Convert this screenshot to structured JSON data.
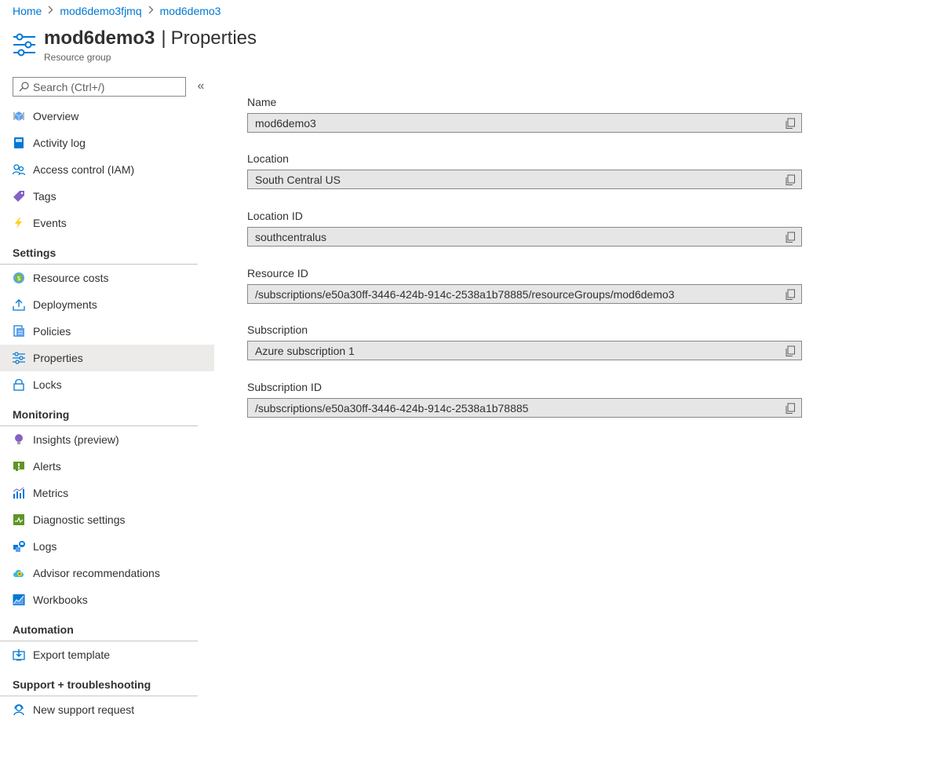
{
  "breadcrumb": {
    "items": [
      "Home",
      "mod6demo3fjmq",
      "mod6demo3"
    ]
  },
  "header": {
    "resource_name": "mod6demo3",
    "separator": "|",
    "section": "Properties",
    "subtitle": "Resource group"
  },
  "search": {
    "placeholder": "Search (Ctrl+/)"
  },
  "collapse_label": "«",
  "sidebar": {
    "top_items": [
      {
        "label": "Overview",
        "icon": "overview-icon"
      },
      {
        "label": "Activity log",
        "icon": "activity-log-icon"
      },
      {
        "label": "Access control (IAM)",
        "icon": "iam-icon"
      },
      {
        "label": "Tags",
        "icon": "tag-icon"
      },
      {
        "label": "Events",
        "icon": "events-icon"
      }
    ],
    "groups": [
      {
        "title": "Settings",
        "items": [
          {
            "label": "Resource costs",
            "icon": "costs-icon"
          },
          {
            "label": "Deployments",
            "icon": "deployments-icon"
          },
          {
            "label": "Policies",
            "icon": "policies-icon"
          },
          {
            "label": "Properties",
            "icon": "properties-icon",
            "active": true
          },
          {
            "label": "Locks",
            "icon": "lock-icon"
          }
        ]
      },
      {
        "title": "Monitoring",
        "items": [
          {
            "label": "Insights (preview)",
            "icon": "insights-icon"
          },
          {
            "label": "Alerts",
            "icon": "alerts-icon"
          },
          {
            "label": "Metrics",
            "icon": "metrics-icon"
          },
          {
            "label": "Diagnostic settings",
            "icon": "diagnostic-icon"
          },
          {
            "label": "Logs",
            "icon": "logs-icon"
          },
          {
            "label": "Advisor recommendations",
            "icon": "advisor-icon"
          },
          {
            "label": "Workbooks",
            "icon": "workbooks-icon"
          }
        ]
      },
      {
        "title": "Automation",
        "items": [
          {
            "label": "Export template",
            "icon": "export-icon"
          }
        ]
      },
      {
        "title": "Support + troubleshooting",
        "items": [
          {
            "label": "New support request",
            "icon": "support-icon"
          }
        ]
      }
    ]
  },
  "fields": [
    {
      "label": "Name",
      "value": "mod6demo3"
    },
    {
      "label": "Location",
      "value": "South Central US"
    },
    {
      "label": "Location ID",
      "value": "southcentralus"
    },
    {
      "label": "Resource ID",
      "value": "/subscriptions/e50a30ff-3446-424b-914c-2538a1b78885/resourceGroups/mod6demo3"
    },
    {
      "label": "Subscription",
      "value": "Azure subscription 1"
    },
    {
      "label": "Subscription ID",
      "value": "/subscriptions/e50a30ff-3446-424b-914c-2538a1b78885"
    }
  ],
  "colors": {
    "accent": "#0078d4",
    "active_bg": "#edebe9",
    "field_bg": "#e6e6e6"
  }
}
